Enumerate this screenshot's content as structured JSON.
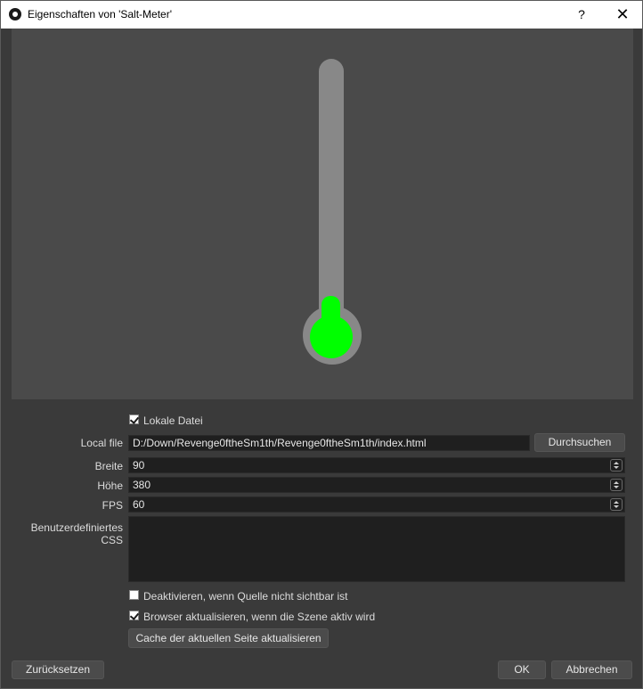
{
  "window": {
    "title": "Eigenschaften von 'Salt-Meter'",
    "help_label": "?",
    "close_label": "✕"
  },
  "preview": {
    "thermometer_fill_color": "#00ff00",
    "thermometer_tube_color": "#888888",
    "thermometer_level": 0.0
  },
  "form": {
    "local_file_checkbox": {
      "label": "Lokale Datei",
      "checked": true
    },
    "local_file": {
      "label": "Local file",
      "value": "D:/Down/Revenge0ftheSm1th/Revenge0ftheSm1th/index.html",
      "browse_label": "Durchsuchen"
    },
    "width": {
      "label": "Breite",
      "value": "90"
    },
    "height": {
      "label": "Höhe",
      "value": "380"
    },
    "fps": {
      "label": "FPS",
      "value": "60"
    },
    "custom_css": {
      "label": "Benutzerdefiniertes CSS",
      "value": ""
    },
    "shutdown_checkbox": {
      "label": "Deaktivieren, wenn Quelle nicht sichtbar ist",
      "checked": false
    },
    "refresh_checkbox": {
      "label": "Browser aktualisieren, wenn die Szene aktiv wird",
      "checked": true
    },
    "refresh_cache_label": "Cache der aktuellen Seite aktualisieren"
  },
  "footer": {
    "reset_label": "Zurücksetzen",
    "ok_label": "OK",
    "cancel_label": "Abbrechen"
  }
}
